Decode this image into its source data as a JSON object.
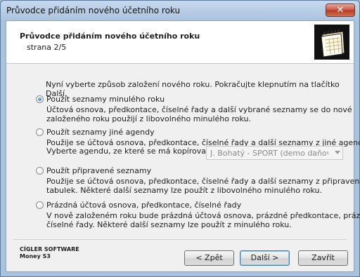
{
  "window": {
    "title": "Průvodce přidáním nového účetního roku",
    "close_glyph": "✕"
  },
  "header": {
    "title": "Průvodce přidáním nového účetního roku",
    "subtitle": "strana 2/5",
    "icon": "calendar-icon"
  },
  "intro": "Nyní vyberte způsob založení nového roku. Pokračujte klepnutím na tlačítko Další.",
  "options": [
    {
      "label": "Použít seznamy minulého roku",
      "selected": true,
      "desc": [
        "Účtová osnova, předkontace, číselné řady a další vybrané seznamy se do nové",
        "založeného roku použijí z libovolného minulého roku."
      ]
    },
    {
      "label": "Použít seznamy jiné agendy",
      "selected": false,
      "desc": [
        "Použije se účtová osnova, předkontace, číselné řady a další seznamy z jiné agendy."
      ],
      "agenda_label": "Vyberte agendu, ze které se má kopírovat:",
      "agenda_value": "J. Bohatý - SPORT (demo daňová e"
    },
    {
      "label": "Použít připravené seznamy",
      "selected": false,
      "desc": [
        "Použije se účtová osnova, předkontace, číselné řady a další seznamy z připravených",
        "tabulek. Některé další seznamy lze použít z libovolného minulého roku."
      ]
    },
    {
      "label": "Prázdná účtová osnova, předkontace, číselné řady",
      "selected": false,
      "desc": [
        "V nově založeném roku bude prázdná účtová osnova, prázdné předkontace, prázdné",
        "číselné řady. Některé další seznamy lze použít z minulého roku."
      ]
    }
  ],
  "brand": {
    "line1": "CÍGLER SOFTWARE",
    "line2": "Money S3"
  },
  "buttons": {
    "back": "< Zpět",
    "next": "Další >",
    "close": "Zavřít"
  }
}
